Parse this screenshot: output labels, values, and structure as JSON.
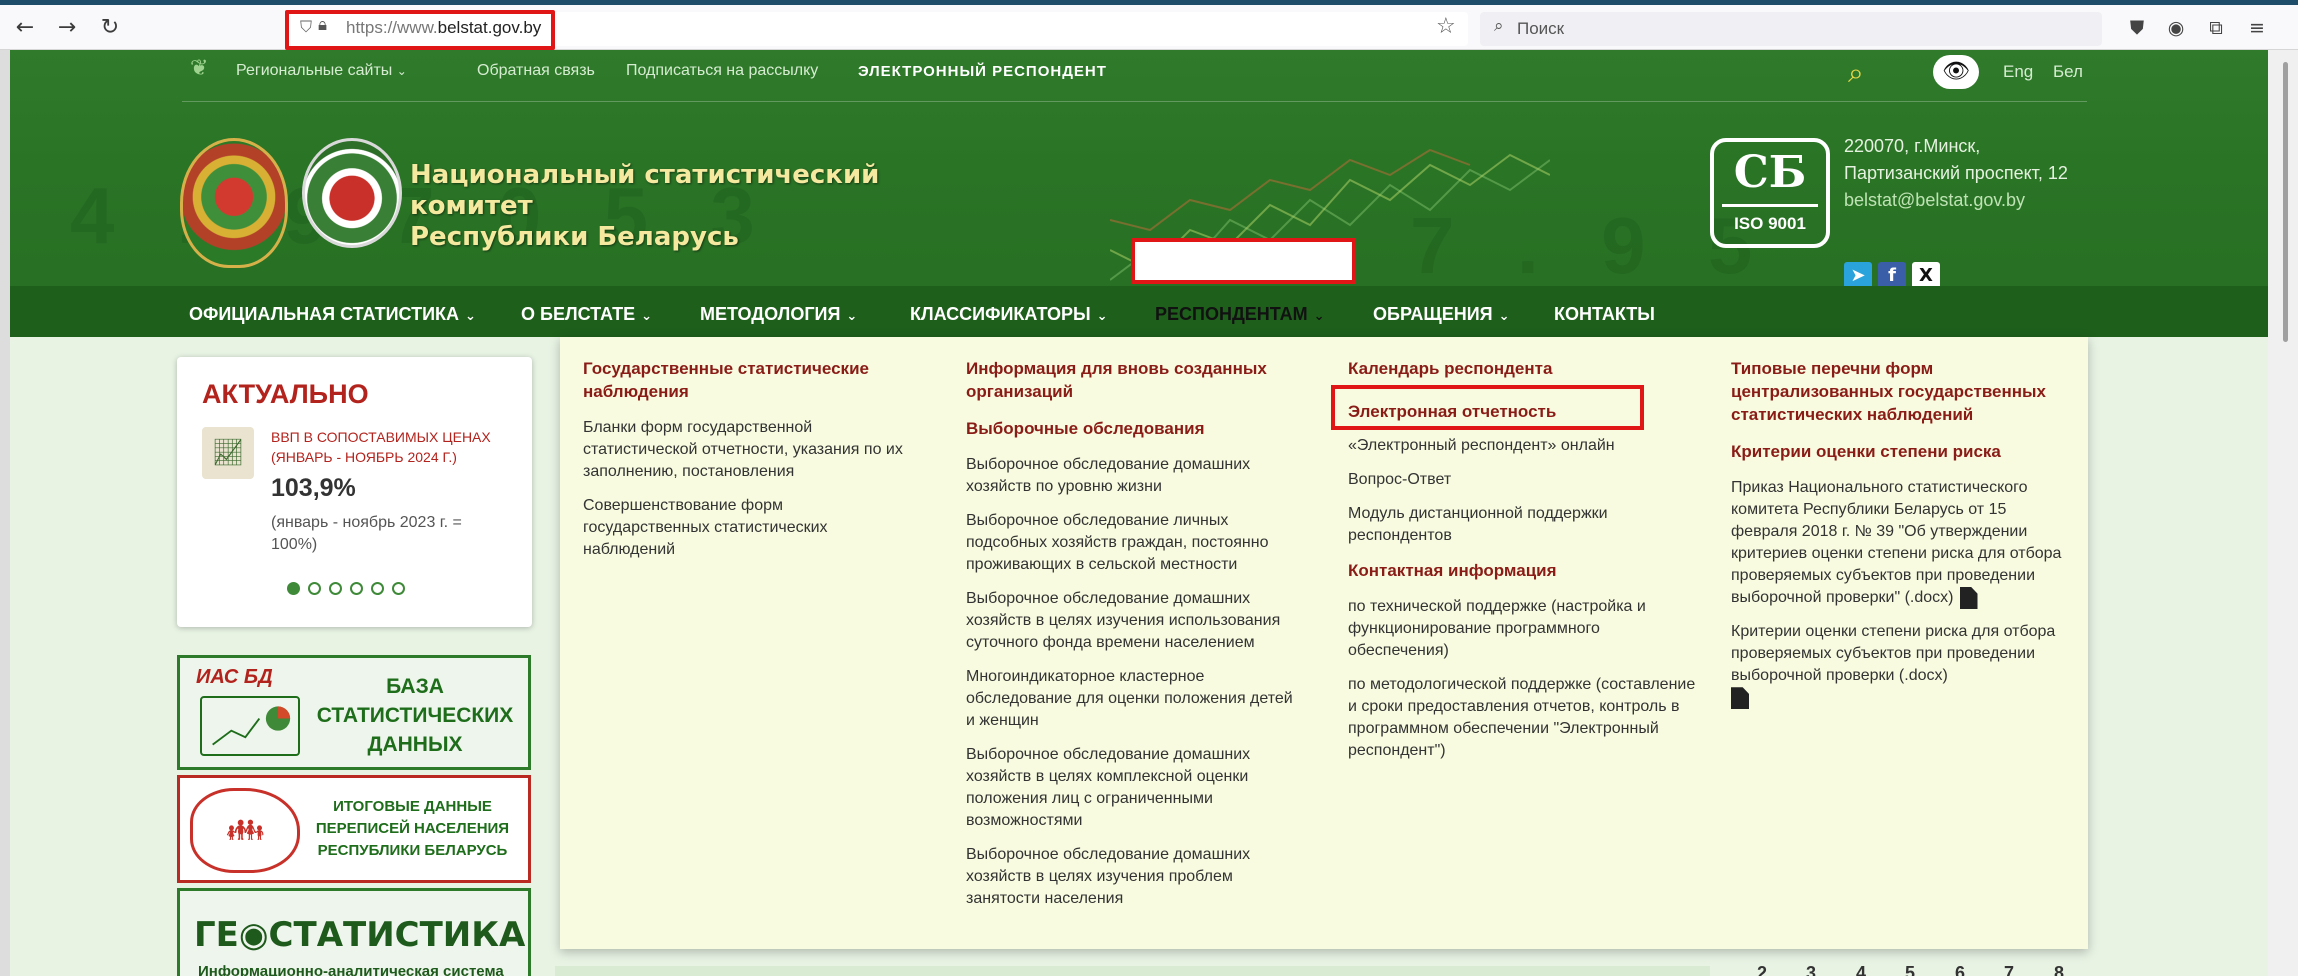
{
  "browser": {
    "url_prefix": "https://www.",
    "url_domain": "belstat.gov.by",
    "search_placeholder": "Поиск",
    "back": "←",
    "forward": "→",
    "reload": "↻"
  },
  "header": {
    "regional_sites": "Региональные сайты",
    "feedback": "Обратная связь",
    "subscribe": "Подписаться на рассылку",
    "e_respondent": "ЭЛЕКТРОННЫЙ РЕСПОНДЕНТ",
    "lang_eng": "Eng",
    "lang_bel": "Бел",
    "org_name_line1": "Национальный статистический комитет",
    "org_name_line2": "Республики Беларусь",
    "iso_mark": "СБ",
    "iso_label": "ISO 9001",
    "address_line1": "220070, г.Минск,",
    "address_line2": "Партизанский проспект, 12",
    "email": "belstat@belstat.gov.by"
  },
  "nav": {
    "items": [
      "ОФИЦИАЛЬНАЯ СТАТИСТИКА",
      "О БЕЛСТАТЕ",
      "МЕТОДОЛОГИЯ",
      "КЛАССИФИКАТОРЫ",
      "РЕСПОНДЕНТАМ",
      "ОБРАЩЕНИЯ",
      "КОНТАКТЫ"
    ],
    "active_index": 4
  },
  "aktual": {
    "title": "АКТУАЛЬНО",
    "link": "ВВП В СОПОСТАВИМЫХ ЦЕНАХ (ЯНВАРЬ - НОЯБРЬ 2024 Г.)",
    "value": "103,9%",
    "note": "(январь - ноябрь 2023 г. = 100%)",
    "slides_count": 6,
    "active_slide": 0
  },
  "banners": {
    "ias_tag": "ИАС БД",
    "ias_title": "БАЗА СТАТИСТИЧЕСКИХ ДАННЫХ",
    "census_title": "ИТОГОВЫЕ ДАННЫЕ ПЕРЕПИСЕЙ НАСЕЛЕНИЯ РЕСПУБЛИКИ БЕЛАРУСЬ",
    "geo_title": "ГЕ◉СТАТИСТИКА",
    "geo_sub": "Информационно-аналитическая система"
  },
  "dropdown": {
    "col1": {
      "head": "Государственные статистические наблюдения",
      "links": [
        "Бланки форм государственной статистической отчетности, указания по их заполнению, постановления",
        "Совершенствование форм государственных статистических наблюдений"
      ]
    },
    "col2": {
      "head1": "Информация для вновь созданных организаций",
      "head2": "Выборочные обследования",
      "links": [
        "Выборочное обследование домашних хозяйств по уровню жизни",
        "Выборочное обследование личных подсобных хозяйств граждан, постоянно проживающих в сельской местности",
        "Выборочное обследование домашних хозяйств в целях изучения использования суточного фонда времени населением",
        "Многоиндикаторное кластерное обследование для оценки положения детей и женщин",
        "Выборочное обследование домашних хозяйств в целях комплексной оценки положения лиц с ограниченными возможностями",
        "Выборочное обследование домашних хозяйств в целях изучения проблем занятости населения"
      ]
    },
    "col3": {
      "head1": "Календарь респондента",
      "head2": "Электронная отчетность",
      "links": [
        "«Электронный респондент» онлайн",
        "Вопрос-Ответ",
        "Модуль дистанционной поддержки респондентов"
      ],
      "head3": "Контактная информация",
      "contacts": [
        "по технической поддержке (настройка и функционирование программного обеспечения)",
        "по методологической поддержке (составление и сроки предоставления отчетов, контроль в программном обеспечении \"Электронный респондент\")"
      ]
    },
    "col4": {
      "head1": "Типовые перечни форм централизованных государственных статистических наблюдений",
      "head2": "Критерии оценки степени риска",
      "doc1": "Приказ Национального статистического комитета Республики Беларусь от 15 февраля 2018 г. № 39 \"Об утверждении критериев оценки степени риска для отбора проверяемых субъектов при проведении выборочной проверки\" (.docx)",
      "doc2": "Критерии оценки степени риска для отбора проверяемых субъектов при проведении выборочной проверки (.docx)"
    }
  },
  "pager": [
    "2",
    "3",
    "4",
    "5",
    "6",
    "7",
    "8"
  ],
  "colors": {
    "header_green": "#2a7426",
    "nav_green": "#1e5f1c",
    "accent_red": "#8a1c17",
    "dropdown_bg": "#f8fbdf",
    "highlight": "#e01515"
  }
}
